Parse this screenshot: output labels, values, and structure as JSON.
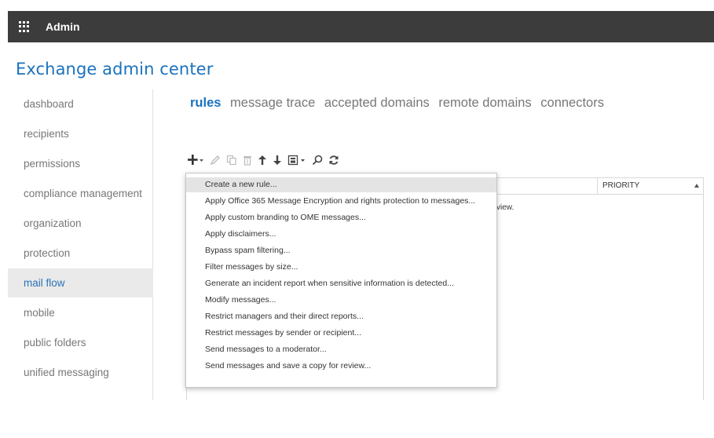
{
  "topbar": {
    "title": "Admin"
  },
  "page_title": "Exchange admin center",
  "sidebar": {
    "items": [
      {
        "label": "dashboard",
        "active": false
      },
      {
        "label": "recipients",
        "active": false
      },
      {
        "label": "permissions",
        "active": false
      },
      {
        "label": "compliance management",
        "active": false
      },
      {
        "label": "organization",
        "active": false
      },
      {
        "label": "protection",
        "active": false
      },
      {
        "label": "mail flow",
        "active": true
      },
      {
        "label": "mobile",
        "active": false
      },
      {
        "label": "public folders",
        "active": false
      },
      {
        "label": "unified messaging",
        "active": false
      }
    ]
  },
  "tabs": [
    {
      "label": "rules",
      "active": true
    },
    {
      "label": "message trace",
      "active": false
    },
    {
      "label": "accepted domains",
      "active": false
    },
    {
      "label": "remote domains",
      "active": false
    },
    {
      "label": "connectors",
      "active": false
    }
  ],
  "toolbar": {
    "icons": [
      "add-icon",
      "edit-icon",
      "copy-icon",
      "delete-icon",
      "move-up-icon",
      "move-down-icon",
      "export-icon",
      "search-icon",
      "refresh-icon"
    ]
  },
  "table": {
    "columns": {
      "priority": "PRIORITY"
    },
    "empty_text_visible": "view."
  },
  "menu": {
    "items": [
      "Create a new rule...",
      "Apply Office 365 Message Encryption and rights protection to messages...",
      "Apply custom branding to OME messages...",
      "Apply disclaimers...",
      "Bypass spam filtering...",
      "Filter messages by size...",
      "Generate an incident report when sensitive information is detected...",
      "Modify messages...",
      "Restrict managers and their direct reports...",
      "Restrict messages by sender or recipient...",
      "Send messages to a moderator...",
      "Send messages and save a copy for review..."
    ],
    "highlighted_index": 0
  },
  "colors": {
    "topbar": "#3c3c3c",
    "accent": "#1b72be",
    "sidebar_active_bg": "#eaeaea"
  }
}
